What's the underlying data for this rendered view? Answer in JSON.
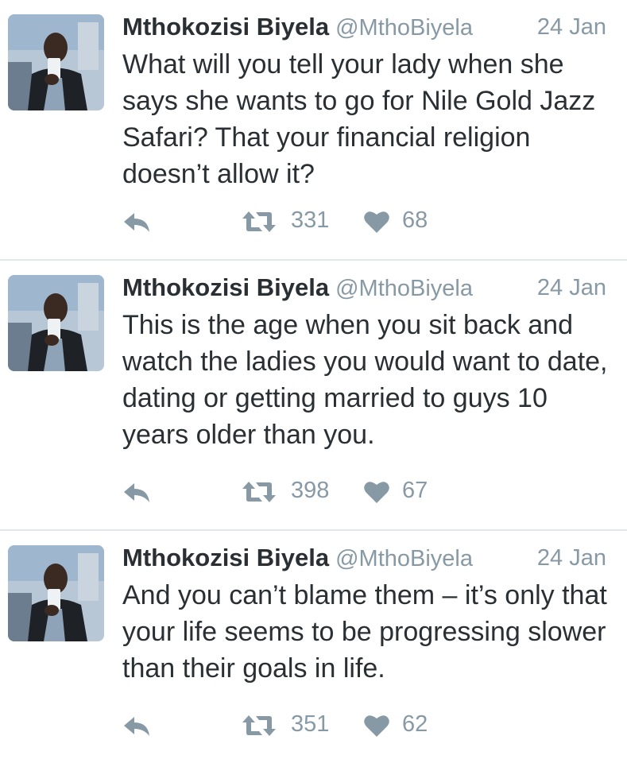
{
  "tweets": [
    {
      "author": "Mthokozisi Biyela",
      "handle": "@MthoBiyela",
      "date": "24 Jan",
      "text": "What will you tell your lady when she says she wants to go for Nile Gold Jazz Safari? That your financial religion doesn’t allow it?",
      "retweets": "331",
      "likes": "68"
    },
    {
      "author": "Mthokozisi Biyela",
      "handle": "@MthoBiyela",
      "date": "24 Jan",
      "text": "This is the age when you sit back and watch the ladies you would want to date, dating or getting married to guys 10 years older than you.",
      "retweets": "398",
      "likes": "67"
    },
    {
      "author": "Mthokozisi Biyela",
      "handle": "@MthoBiyela",
      "date": "24 Jan",
      "text": "And you can’t blame them – it’s only that your life seems to be progressing slower than their goals in life.",
      "retweets": "351",
      "likes": "62"
    }
  ],
  "icons": {
    "reply": "reply-icon",
    "retweet": "retweet-icon",
    "like": "heart-icon"
  },
  "colors": {
    "icon": "#8899a6",
    "text": "#292f33",
    "muted": "#8899a6",
    "divider": "#e1e8ed"
  }
}
